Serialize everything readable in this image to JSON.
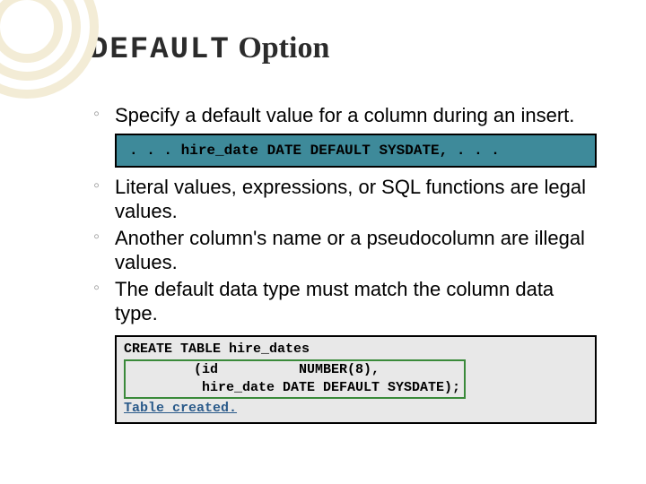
{
  "title": {
    "mono": "DEFAULT",
    "rest": " Option"
  },
  "bullets": {
    "b1": "Specify a default value for a column during an insert.",
    "code1": ". . . hire_date DATE DEFAULT SYSDATE, . . .",
    "b2": "Literal values, expressions, or SQL functions are legal values.",
    "b3": "Another column's name or a pseudocolumn are illegal values.",
    "b4": "The default data type must match the column data type."
  },
  "code2": {
    "line1": "CREATE TABLE hire_dates",
    "line2": "        (id          NUMBER(8),",
    "line3": "         hire_date DATE DEFAULT SYSDATE);",
    "result": "Table created."
  }
}
